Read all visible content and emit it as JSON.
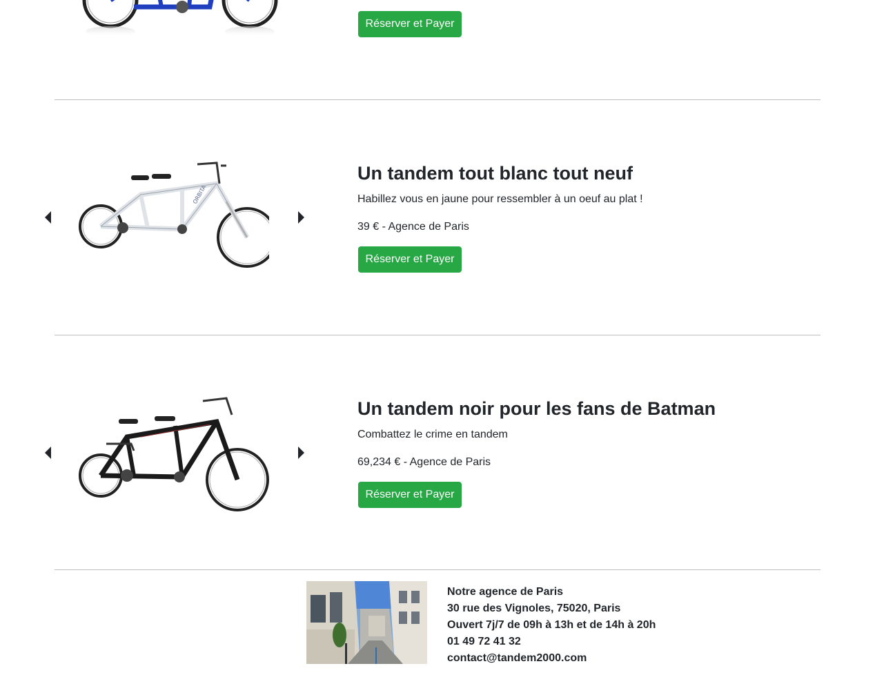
{
  "products": [
    {
      "button_label": "Réserver et Payer",
      "bike_color": "#1f3fbf"
    },
    {
      "title": "Un tandem tout blanc tout neuf",
      "description": "Habillez vous en jaune pour ressembler à un oeuf au plat !",
      "price_line": "39 € - Agence de Paris",
      "button_label": "Réserver et Payer",
      "bike_color": "#f4f6f8",
      "bike_brand": "ORBITA"
    },
    {
      "title": "Un tandem noir pour les fans de Batman",
      "description": "Combattez le crime en tandem",
      "price_line": "69,234 € - Agence de Paris",
      "button_label": "Réserver et Payer",
      "bike_color": "#1a1a1a"
    }
  ],
  "carousel": {
    "prev_icon": "caret-left-icon",
    "next_icon": "caret-right-icon"
  },
  "footer": {
    "agency_title": "Notre agence de Paris",
    "address": "30 rue des Vignoles, 75020, Paris",
    "hours": "Ouvert 7j/7 de 09h à 13h et de 14h à 20h",
    "phone": "01 49 72 41 32",
    "email": "contact@tandem2000.com"
  },
  "colors": {
    "button_bg": "#28a745",
    "text": "#212529",
    "divider": "#bdbdbd"
  }
}
